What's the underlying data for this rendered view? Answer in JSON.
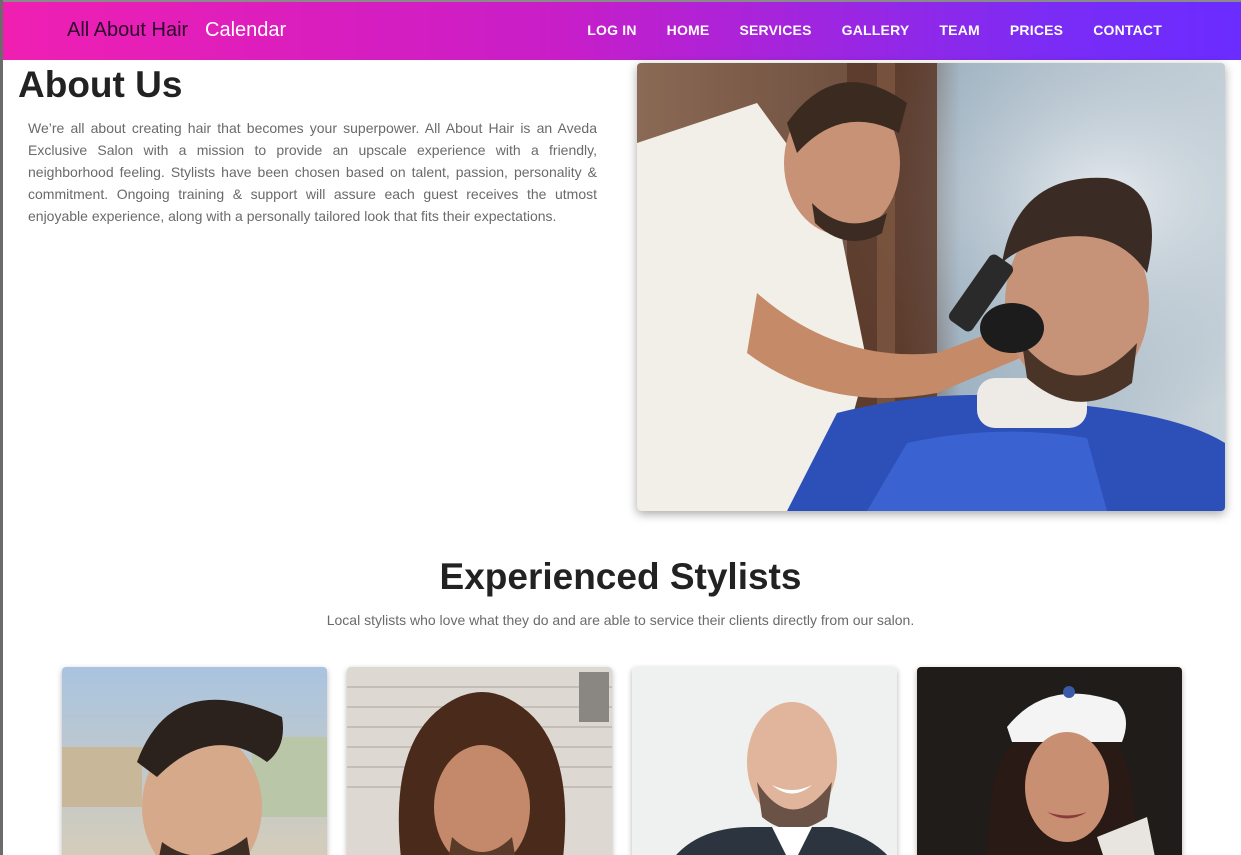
{
  "navbar": {
    "brand": "All About Hair",
    "calendar": "Calendar",
    "links": [
      "LOG IN",
      "HOME",
      "SERVICES",
      "GALLERY",
      "TEAM",
      "PRICES",
      "CONTACT"
    ]
  },
  "about": {
    "title": "About Us",
    "text": "We’re all about creating hair that becomes your superpower. All About Hair is an Aveda Exclusive Salon with a mission to provide an upscale experience with a friendly, neighborhood feeling. Stylists have been chosen based on talent, passion, personality & commitment. Ongoing training & support will assure each guest receives the utmost enjoyable experience, along with a personally tailored look that fits their expectations."
  },
  "stylists": {
    "title": "Experienced Stylists",
    "subtitle": "Local stylists who love what they do and are able to service their clients directly from our salon."
  },
  "colors": {
    "nav_gradient_start": "#f01fb2",
    "nav_gradient_end": "#6a2cff"
  }
}
